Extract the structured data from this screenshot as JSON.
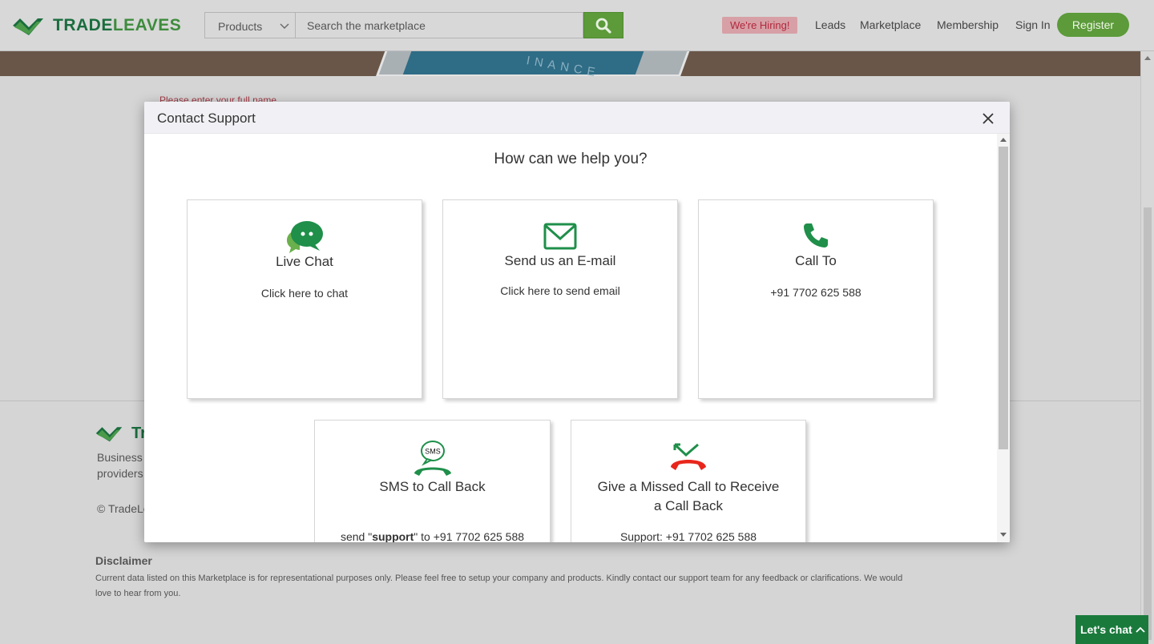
{
  "header": {
    "brand_part1": "TRADE",
    "brand_part2": "LEAVES",
    "category_select": "Products",
    "search_placeholder": "Search the marketplace",
    "hiring_badge": "We're Hiring!",
    "nav": {
      "leads": "Leads",
      "marketplace": "Marketplace",
      "membership": "Membership",
      "sign_in": "Sign In",
      "register": "Register"
    }
  },
  "hero": {
    "banner_word": "INANCE"
  },
  "page": {
    "form_hint": "Please enter your full name",
    "footer": {
      "brand_fragment": "Tr",
      "about_line1": "Business",
      "about_line2": "providers",
      "copyright": "© TradeLe",
      "disclaimer_title": "Disclaimer",
      "disclaimer_text": "Current data listed on this Marketplace is for representational purposes only. Please feel free to setup your company and products. Kindly contact our support team for any feedback or clarifications. We would love to hear from you."
    },
    "chat_widget": "Let's chat"
  },
  "modal": {
    "title": "Contact Support",
    "heading": "How can we help you?",
    "cards": [
      {
        "title": "Live Chat",
        "subtitle": "Click here to chat",
        "icon": "chat-bubbles-icon"
      },
      {
        "title": "Send us an E-mail",
        "subtitle": "Click here to send email",
        "icon": "envelope-icon"
      },
      {
        "title": "Call To",
        "subtitle": "+91 7702 625 588",
        "icon": "phone-icon"
      },
      {
        "title": "SMS to Call Back",
        "subtitle_prefix": "send \"",
        "subtitle_bold": "support",
        "subtitle_mid": "\" to ",
        "subtitle_number": "+91 7702 625 588",
        "icon": "sms-phone-icon",
        "icon_text": "SMS"
      },
      {
        "title_line1": "Give a Missed Call to Receive",
        "title_line2": "a Call Back",
        "subtitle_prefix": "Support: ",
        "subtitle_number": "+91 7702 625 588",
        "icon": "missed-call-icon"
      }
    ]
  },
  "colors": {
    "brand_green": "#5c9a3a",
    "dark_green": "#1a7a3c",
    "icon_green": "#1f8f4a",
    "missed_red": "#e8261b",
    "hiring_bg": "#d7a0a6"
  }
}
